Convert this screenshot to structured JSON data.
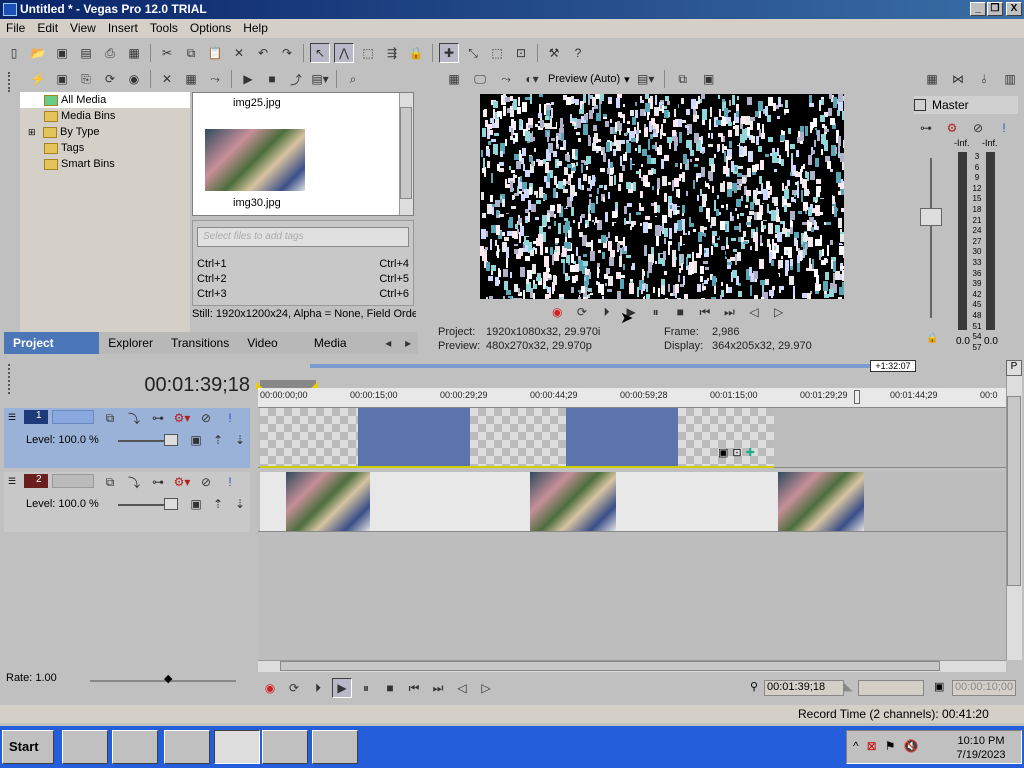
{
  "window": {
    "title": "Untitled * - Vegas Pro 12.0 TRIAL",
    "min": "_",
    "max": "❐",
    "close": "X"
  },
  "menu": [
    "File",
    "Edit",
    "View",
    "Insert",
    "Tools",
    "Options",
    "Help"
  ],
  "media": {
    "tree": [
      "All Media",
      "Media Bins",
      "By Type",
      "Tags",
      "Smart Bins"
    ],
    "thumb1": "img25.jpg",
    "thumb2": "img30.jpg",
    "tag_placeholder": "Select files to add tags",
    "shortcuts": [
      {
        "l": "Ctrl+1",
        "r": "Ctrl+4"
      },
      {
        "l": "Ctrl+2",
        "r": "Ctrl+5"
      },
      {
        "l": "Ctrl+3",
        "r": "Ctrl+6"
      }
    ],
    "still_info": "Still: 1920x1200x24, Alpha = None, Field Orde",
    "tabs": [
      "Project Media",
      "Explorer",
      "Transitions",
      "Video FX",
      "Media Ger"
    ]
  },
  "preview": {
    "mode": "Preview (Auto)",
    "project_label": "Project:",
    "project_val": "1920x1080x32, 29.970i",
    "preview_label": "Preview:",
    "preview_val": "480x270x32, 29.970p",
    "frame_label": "Frame:",
    "frame_val": "2,986",
    "display_label": "Display:",
    "display_val": "364x205x32, 29.970"
  },
  "master": {
    "label": "Master",
    "inf_l": "-Inf.",
    "inf_r": "-Inf.",
    "scale": [
      "3",
      "6",
      "9",
      "12",
      "15",
      "18",
      "21",
      "24",
      "27",
      "30",
      "33",
      "36",
      "39",
      "42",
      "45",
      "48",
      "51",
      "54",
      "57"
    ],
    "bot_l": "0.0",
    "bot_r": "0.0"
  },
  "timeline": {
    "timecode": "00:01:39;18",
    "region_end": "+1:32:07",
    "ruler": [
      "00:00:00;00",
      "00:00:15;00",
      "00:00:29;29",
      "00:00:44;29",
      "00:00:59;28",
      "00:01:15;00",
      "00:01:29;29",
      "00:01:44;29",
      "00:0"
    ],
    "track1": {
      "num": "1",
      "level": "Level: 100.0 %"
    },
    "track2": {
      "num": "2",
      "level": "Level: 100.0 %"
    }
  },
  "bottom": {
    "rate": "Rate: 1.00",
    "tc1": "00:01:39;18",
    "tc2": "00:00:10;00"
  },
  "status": {
    "record": "Record Time (2 channels): 00:41:20"
  },
  "taskbar": {
    "start": "Start",
    "time": "10:10 PM",
    "date": "7/19/2023"
  },
  "colors": {
    "title_bar": "#0a246a",
    "taskbar": "#245edb",
    "track_selected": "#9bb2d8",
    "record": "#d02020"
  }
}
